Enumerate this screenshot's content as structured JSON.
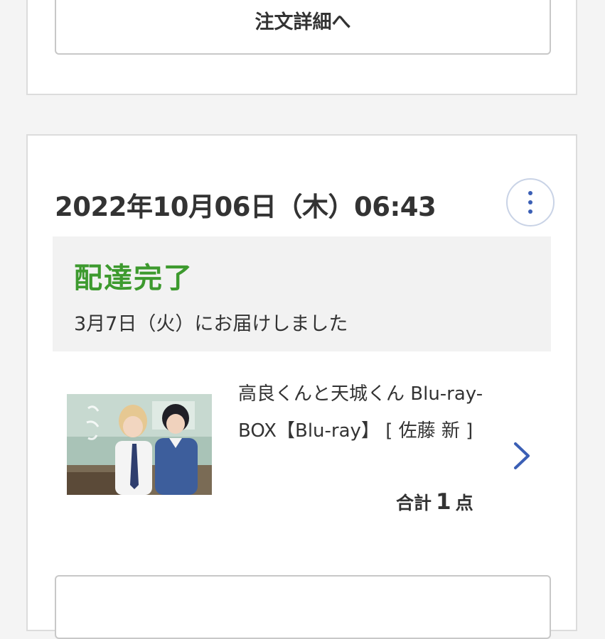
{
  "top_card": {
    "order_detail_button": "注文詳細へ"
  },
  "order": {
    "datetime": "2022年10月06日（木）06:43",
    "more_icon": "vertical-ellipsis-icon",
    "status": {
      "title": "配達完了",
      "subtitle": "3月7日（火）にお届けしました",
      "color": "#3d9a2e"
    },
    "product": {
      "title": "高良くんと天城くん Blu-ray-BOX【Blu-ray】 [ 佐藤 新 ]",
      "thumbnail": "product-thumbnail"
    },
    "total": {
      "prefix": "合計",
      "count": "1",
      "suffix": "点"
    },
    "accent_color": "#3b5fb5"
  }
}
